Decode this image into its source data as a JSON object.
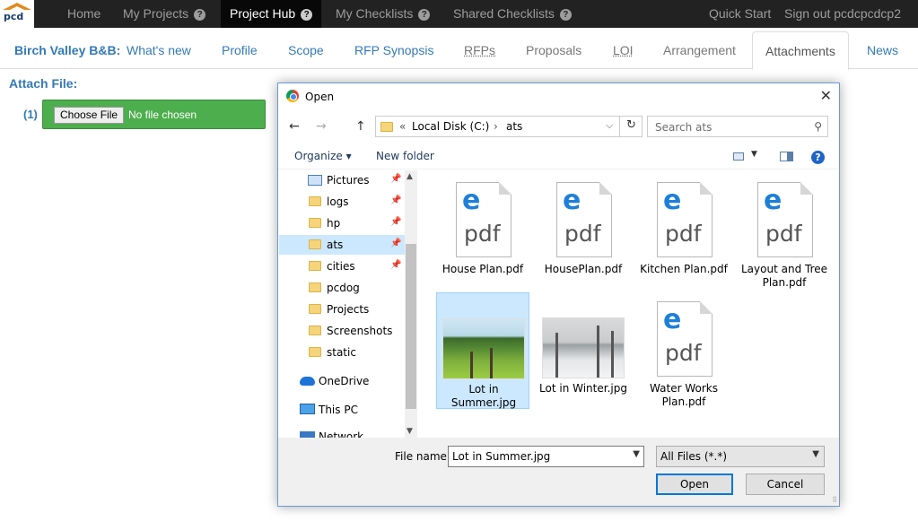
{
  "topnav": {
    "home": "Home",
    "my_projects": "My Projects",
    "project_hub": "Project Hub",
    "my_checklists": "My Checklists",
    "shared_checklists": "Shared Checklists",
    "quick_start": "Quick Start",
    "sign_out": "Sign out pcdcpcdcp2",
    "help_glyph": "?",
    "logo_text": "pcd"
  },
  "tabs": {
    "brand": "Birch Valley B&B:",
    "whats_new": "What's new",
    "profile": "Profile",
    "scope": "Scope",
    "rfp_synopsis": "RFP Synopsis",
    "rfps": "RFPs",
    "proposals": "Proposals",
    "loi": "LOI",
    "arrangement": "Arrangement",
    "attachments": "Attachments",
    "news": "News"
  },
  "attach": {
    "label": "Attach File:",
    "number": "(1)",
    "choose_button": "Choose File",
    "status": "No file chosen"
  },
  "dialog": {
    "title": "Open",
    "close": "✕",
    "back": "←",
    "forward": "→",
    "up": "↑",
    "crumb_prefix": "«",
    "crumb_drive": "Local Disk (C:)",
    "crumb_sep": "›",
    "crumb_folder": "ats",
    "addr_dropdown": "⌵",
    "refresh": "↻",
    "search_placeholder": "Search ats",
    "search_icon": "⚲",
    "organize": "Organize ▾",
    "new_folder": "New folder",
    "view_dropdown": "▼",
    "help": "?",
    "sidebar": [
      {
        "label": "Pictures",
        "pinned": true
      },
      {
        "label": "logs",
        "pinned": true
      },
      {
        "label": "hp",
        "pinned": true
      },
      {
        "label": "ats",
        "pinned": true
      },
      {
        "label": "cities",
        "pinned": true
      },
      {
        "label": "pcdog",
        "pinned": false
      },
      {
        "label": "Projects",
        "pinned": false
      },
      {
        "label": "Screenshots",
        "pinned": false
      },
      {
        "label": "static",
        "pinned": false
      },
      {
        "label": "OneDrive",
        "pinned": false
      },
      {
        "label": "This PC",
        "pinned": false
      },
      {
        "label": "Network",
        "pinned": false
      }
    ],
    "pin_glyph": "📌",
    "scroll_up": "▲",
    "scroll_down": "▼",
    "files": [
      {
        "name": "House Plan.pdf",
        "type": "pdf"
      },
      {
        "name": "HousePlan.pdf",
        "type": "pdf"
      },
      {
        "name": "Kitchen Plan.pdf",
        "type": "pdf"
      },
      {
        "name": "Layout and Tree Plan.pdf",
        "type": "pdf"
      },
      {
        "name": "Lot in Summer.jpg",
        "type": "jpg"
      },
      {
        "name": "Lot in Winter.jpg",
        "type": "jpg"
      },
      {
        "name": "Water Works Plan.pdf",
        "type": "pdf"
      }
    ],
    "pdf_e": "e",
    "pdf_text": "pdf",
    "file_name_label": "File name:",
    "file_name_value": "Lot in Summer.jpg",
    "file_name_dropdown": "▼",
    "file_type": "All Files (*.*)",
    "file_type_dropdown": "▼",
    "open_button": "Open",
    "cancel_button": "Cancel",
    "grip": "⠿"
  },
  "colors": {
    "topbar_bg": "#222222",
    "link_blue": "#337ab7",
    "attach_green": "#4cae4c",
    "selection_blue": "#cce8ff",
    "dialog_border": "#6a9bd4"
  }
}
